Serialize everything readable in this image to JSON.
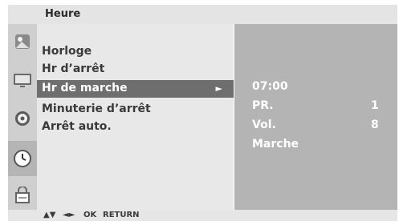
{
  "title": "Heure",
  "sidebar": {
    "icons": [
      "picture-icon",
      "screen-icon",
      "disc-icon",
      "clock-icon",
      "lock-icon"
    ],
    "active": "clock-icon"
  },
  "menu": {
    "items": [
      {
        "label": "Horloge"
      },
      {
        "label": "Hr d’arrêt"
      },
      {
        "label": "Hr de marche",
        "selected": true
      },
      {
        "label": "Minuterie d’arrêt"
      },
      {
        "label": "Arrêt auto."
      }
    ],
    "selected_arrow": "►"
  },
  "submenu": {
    "time": "07:00",
    "rows": [
      {
        "label": "PR.",
        "value": "1"
      },
      {
        "label": "Vol.",
        "value": "8"
      },
      {
        "label": "Marche",
        "value": ""
      }
    ]
  },
  "help": {
    "updown": "▲▼",
    "leftright": "◄►",
    "ok": "OK",
    "return": "RETURN"
  },
  "colors": {
    "title_bar": "#e4e4e4",
    "sidebar": "#cfcfcf",
    "menu_panel": "#e8e8e8",
    "selected_row": "#6e6e6e",
    "sub_panel": "#b4b4b4"
  }
}
